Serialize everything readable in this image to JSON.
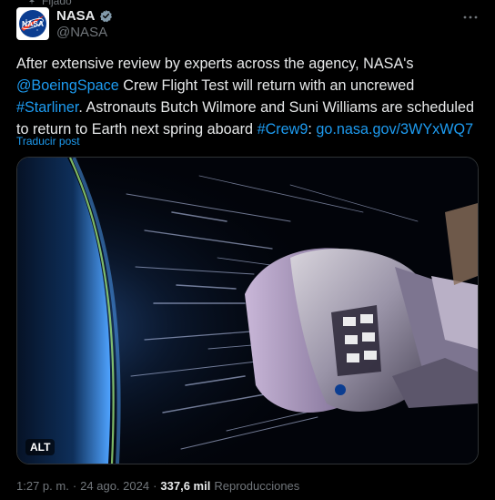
{
  "pinned_label": "Fijado",
  "author": {
    "display_name": "NASA",
    "handle": "@NASA",
    "avatar_text": "NASA",
    "verified_icon": "verified-badge-icon"
  },
  "more_icon": "more-horizontal-icon",
  "tweet": {
    "segments": [
      {
        "text": "After extensive review by experts across the agency, NASA's ",
        "link": false
      },
      {
        "text": "@BoeingSpace",
        "link": true
      },
      {
        "text": " Crew Flight Test will return with an uncrewed ",
        "link": false
      },
      {
        "text": "#Starliner",
        "link": true
      },
      {
        "text": ". Astronauts Butch Wilmore and Suni Williams are scheduled to return to Earth next spring aboard ",
        "link": false
      },
      {
        "text": "#Crew9",
        "link": true
      },
      {
        "text": ": ",
        "link": false
      },
      {
        "text": "go.nasa.gov/3WYxWQ7",
        "link": true
      }
    ]
  },
  "translate_label": "Traducir post",
  "media": {
    "alt_label": "ALT"
  },
  "meta": {
    "time": "1:27 p. m.",
    "separator": "·",
    "date": "24 ago. 2024",
    "views_count": "337,6 mil",
    "views_label": "Reproducciones"
  },
  "colors": {
    "background": "#000000",
    "text": "#e7e9ea",
    "muted": "#71767b",
    "link": "#1d9bf0",
    "nasa_blue": "#0b3d91",
    "nasa_red": "#fc3d21"
  }
}
